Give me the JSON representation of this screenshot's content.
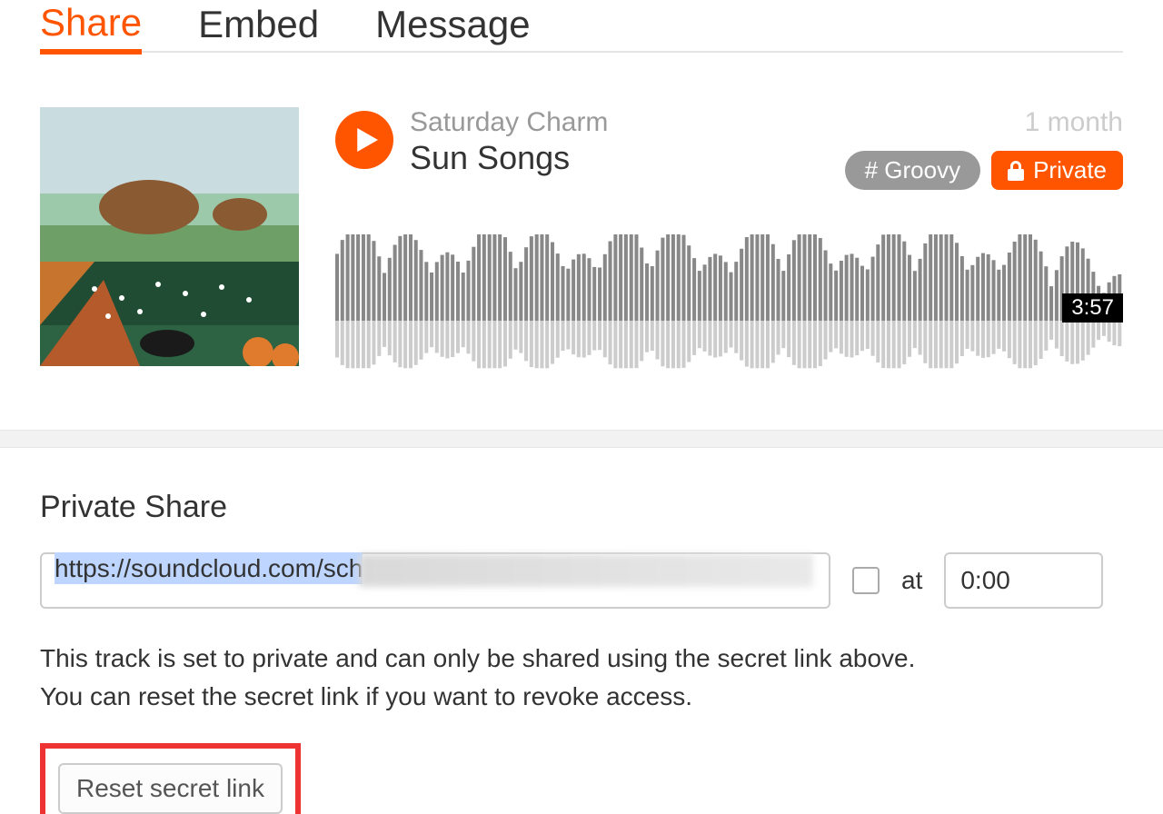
{
  "tabs": {
    "share": {
      "label": "Share",
      "active": true
    },
    "embed": {
      "label": "Embed",
      "active": false
    },
    "message": {
      "label": "Message",
      "active": false
    }
  },
  "track": {
    "artist": "Saturday Charm",
    "title": "Sun Songs",
    "time_ago": "1 month",
    "tag": "# Groovy",
    "privacy_label": "Private",
    "duration": "3:57"
  },
  "colors": {
    "accent": "#f50",
    "tag_bg": "#999"
  },
  "share": {
    "section_title": "Private Share",
    "link_visible": "https://soundcloud.com/sch",
    "at_label": "at",
    "time_value": "0:00",
    "help_line1": "This track is set to private and can only be shared using the secret link above.",
    "help_line2": "You can reset the secret link if you want to revoke access.",
    "reset_label": "Reset secret link"
  }
}
